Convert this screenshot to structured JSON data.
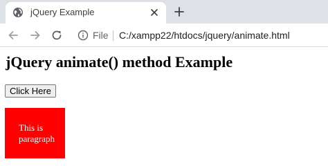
{
  "browser": {
    "tab": {
      "title": "jQuery Example",
      "favicon": "globe-icon",
      "close_icon": "close-icon"
    },
    "new_tab_icon": "plus-icon",
    "toolbar": {
      "back_icon": "arrow-left-icon",
      "forward_icon": "arrow-right-icon",
      "reload_icon": "reload-icon",
      "info_icon": "info-icon",
      "scheme_label": "File",
      "url": "C:/xampp22/htdocs/jquery/animate.html"
    }
  },
  "page": {
    "heading": "jQuery animate() method Example",
    "button_label": "Click Here",
    "box_text": "This is paragraph",
    "box_color": "#ff0000"
  }
}
